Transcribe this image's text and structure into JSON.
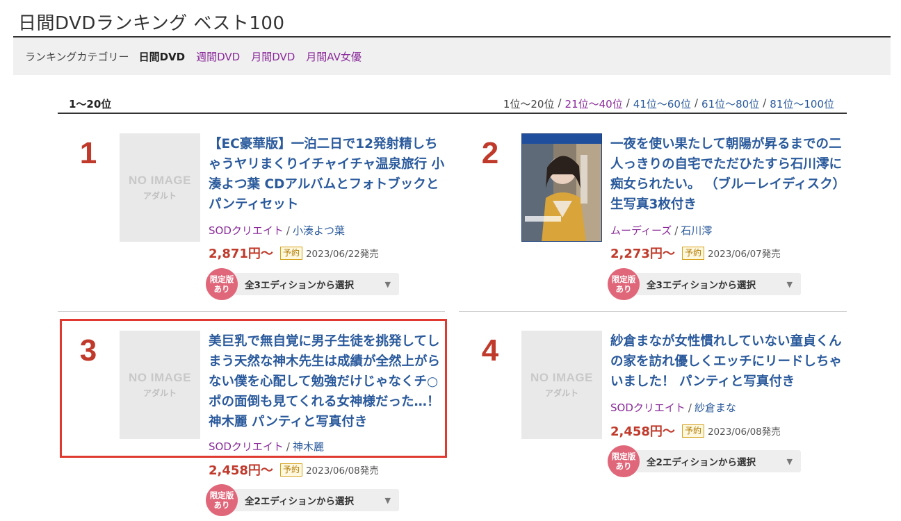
{
  "page_title": "日間DVDランキング ベスト100",
  "category": {
    "label": "ランキングカテゴリー",
    "current": "日間DVD",
    "links": [
      "週間DVD",
      "月間DVD",
      "月間AV女優"
    ]
  },
  "range": {
    "current": "1〜20位",
    "pager": [
      "1位〜20位",
      "21位〜40位",
      "41位〜60位",
      "61位〜80位",
      "81位〜100位"
    ],
    "separator": "/"
  },
  "common": {
    "no_image": "NO IMAGE",
    "adult": "アダルト",
    "reserve_badge": "予約",
    "limited_line1": "限定版",
    "limited_line2": "あり",
    "caret": "▼"
  },
  "items": [
    {
      "rank": "1",
      "title": "【EC豪華版】一泊二日で12発射精しちゃうヤリまくりイチャイチャ温泉旅行 小湊よつ葉 CDアルバムとフォトブックとパンティセット",
      "maker": "SODクリエイト",
      "actor": "小湊よつ葉",
      "price": "2,871円〜",
      "release": "2023/06/22発売",
      "edition": "全3エディションから選択"
    },
    {
      "rank": "2",
      "title": "一夜を使い果たして朝陽が昇るまでの二人っきりの自宅でただひたすら石川澪に痴女られたい。 （ブルーレイディスク） 生写真3枚付き",
      "maker": "ムーディーズ",
      "actor": "石川澪",
      "price": "2,273円〜",
      "release": "2023/06/07発売",
      "edition": "全3エディションから選択"
    },
    {
      "rank": "3",
      "title": "美巨乳で無自覚に男子生徒を挑発してしまう天然な神木先生は成績が全然上がらない僕を心配して勉強だけじゃなくチ○ポの面倒も見てくれる女神様だった…！ 神木麗 パンティと写真付き",
      "maker": "SODクリエイト",
      "actor": "神木麗",
      "price": "2,458円〜",
      "release": "2023/06/08発売",
      "edition": "全2エディションから選択"
    },
    {
      "rank": "4",
      "title": "紗倉まなが女性慣れしていない童貞くんの家を訪れ優しくエッチにリードしちゃいました！ パンティと写真付き",
      "maker": "SODクリエイト",
      "actor": "紗倉まな",
      "price": "2,458円〜",
      "release": "2023/06/08発売",
      "edition": "全2エディションから選択"
    }
  ]
}
